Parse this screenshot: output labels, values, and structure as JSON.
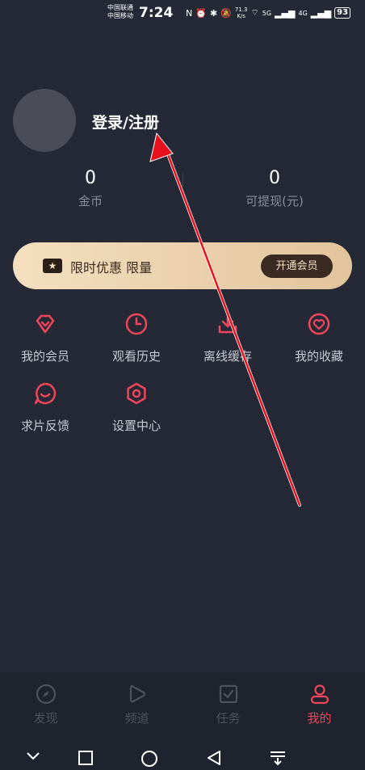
{
  "status_bar": {
    "carrier_1": "中国联通",
    "carrier_2": "中国移动",
    "time": "7:24",
    "net_speed_value": "71.3",
    "net_speed_unit": "K/s",
    "signal_1": "5G",
    "signal_2": "4G",
    "battery": "93"
  },
  "profile": {
    "login_label": "登录/注册"
  },
  "stats": {
    "coins_value": "0",
    "coins_label": "金币",
    "cash_value": "0",
    "cash_label": "可提现(元)"
  },
  "vip_banner": {
    "text": "限时优惠 限量",
    "button": "开通会员"
  },
  "menu": [
    {
      "label": "我的会员",
      "icon": "diamond-icon"
    },
    {
      "label": "观看历史",
      "icon": "clock-icon"
    },
    {
      "label": "离线缓存",
      "icon": "download-icon"
    },
    {
      "label": "我的收藏",
      "icon": "heart-icon"
    },
    {
      "label": "求片反馈",
      "icon": "chat-icon"
    },
    {
      "label": "设置中心",
      "icon": "settings-icon"
    }
  ],
  "tabs": [
    {
      "label": "发现",
      "icon": "compass-icon",
      "active": false
    },
    {
      "label": "频道",
      "icon": "play-icon",
      "active": false
    },
    {
      "label": "任务",
      "icon": "task-icon",
      "active": false
    },
    {
      "label": "我的",
      "icon": "user-icon",
      "active": true
    }
  ],
  "colors": {
    "background": "#252936",
    "accent": "#f0455a",
    "vip_gold": "#e2c49b"
  }
}
